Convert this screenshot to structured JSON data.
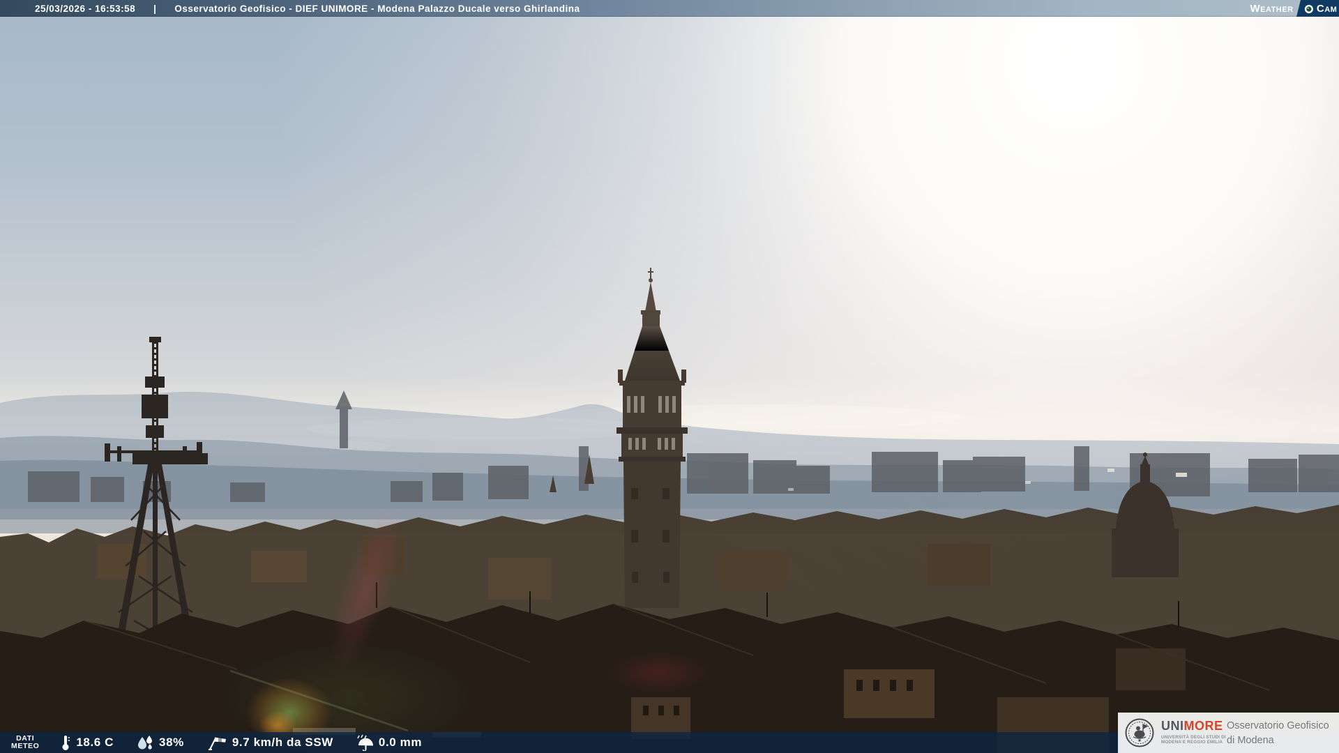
{
  "header": {
    "datetime": "25/03/2026 - 16:53:58",
    "separator": "|",
    "title": "Osservatorio Geofisico - DIEF UNIMORE - Modena Palazzo Ducale verso Ghirlandina",
    "weathercam": {
      "weather_initial": "W",
      "weather_rest": "EATHER",
      "cam_initial": "C",
      "cam_rest": "AM",
      "lens_icon": "camera-lens-icon"
    }
  },
  "footer": {
    "label": {
      "line1": "DATI",
      "line2": "METEO"
    },
    "metrics": [
      {
        "icon": "thermometer-icon",
        "value": "18.6 C"
      },
      {
        "icon": "humidity-drops-icon",
        "value": "38%"
      },
      {
        "icon": "windsock-icon",
        "value": "9.7 km/h da SSW"
      },
      {
        "icon": "rain-umbrella-icon",
        "value": "0.0 mm"
      }
    ]
  },
  "branding": {
    "wordmark_uni": "UNI",
    "wordmark_more": "MORE",
    "university_line1": "UNIVERSITÀ DEGLI STUDI DI",
    "university_line2": "MODENA E REGGIO EMILIA",
    "observatory_line1": "Osservatorio Geofisico",
    "observatory_line2": "di Modena",
    "seal_icon": "unimore-seal-icon"
  },
  "colors": {
    "header_gradient_left": "#33495e",
    "header_gradient_right": "#adbec9",
    "header_text": "#ffffff",
    "weathercam_box": "#0e3a64",
    "footer_bar": "rgba(13,38,66,0.8)",
    "footer_text": "#ffffff",
    "branding_box_bg": "rgba(250,250,250,0.93)",
    "unimore_uni": "#53565c",
    "unimore_more": "#d8432a",
    "observatory_text": "#77787b"
  }
}
